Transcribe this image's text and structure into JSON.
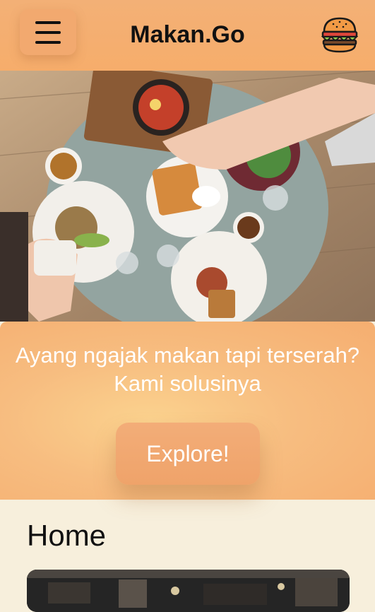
{
  "header": {
    "brand": "Makan.Go",
    "menu_icon": "hamburger-menu-icon",
    "logo_icon": "burger-icon"
  },
  "hero": {
    "image": "food-table-photo"
  },
  "cta": {
    "tagline": "Ayang ngajak makan tapi terserah? Kami solusinya",
    "button_label": "Explore!"
  },
  "main": {
    "section_title": "Home",
    "card_image": "restaurant-photo"
  },
  "colors": {
    "header_bg": "#f6ad6b",
    "accent": "#efa36a",
    "page_bg": "#f7efdc"
  }
}
